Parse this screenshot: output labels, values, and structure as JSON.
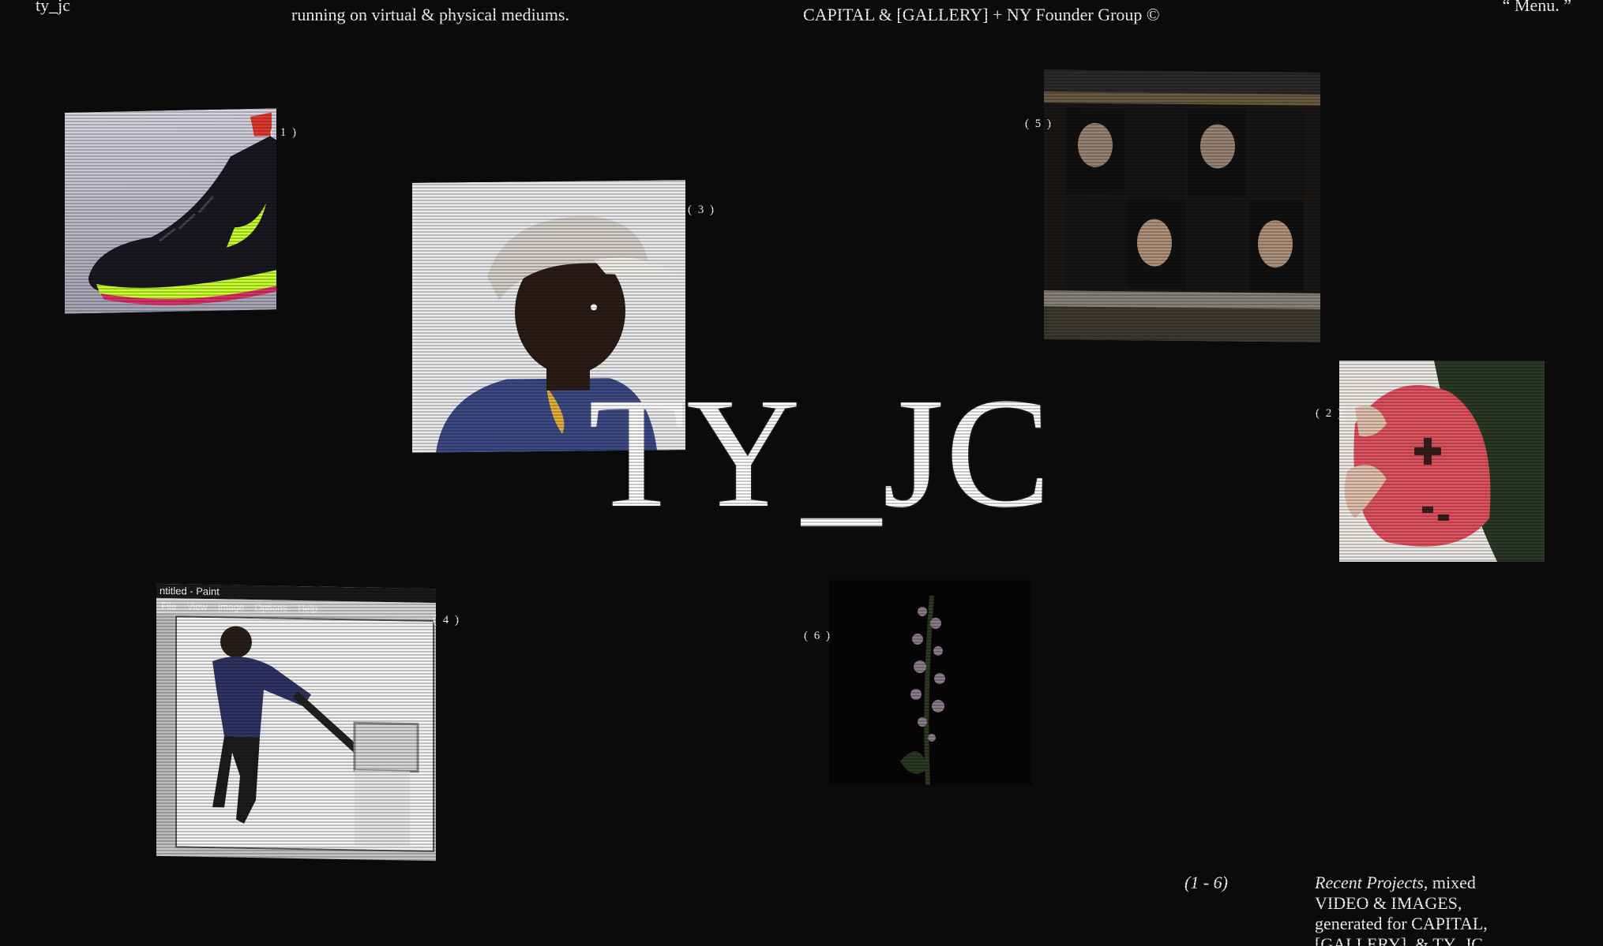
{
  "header": {
    "brand": "ty_jc",
    "description_line2": "running on virtual & physical mediums.",
    "credit": "CAPITAL & [GALLERY] + NY Founder Group ©",
    "menu_label": "“ Menu. ”"
  },
  "hero": {
    "title": "TY_JC"
  },
  "projects": [
    {
      "label": "( 1 )",
      "subject": "sneaker"
    },
    {
      "label": "( 2 )",
      "subject": "game controller"
    },
    {
      "label": "( 3 )",
      "subject": "portrait in cap"
    },
    {
      "label": "( 4 )",
      "subject": "paint window"
    },
    {
      "label": "( 5 )",
      "subject": "street posters"
    },
    {
      "label": "( 6 )",
      "subject": "flowers at night"
    }
  ],
  "paint_window": {
    "title": "ntitled - Paint",
    "menu": [
      "File",
      "View",
      "Image",
      "Options",
      "Help"
    ]
  },
  "footer": {
    "counter": "(1 - 6)",
    "recent_title": "Recent Projects",
    "recent_text": ", mixed VIDEO & IMAGES, generated for CAPITAL, [GALLERY], & TY_JC"
  },
  "colors": {
    "background": "#0b0b0b",
    "text": "#ffffff",
    "sneaker_accent": "#c8ff2e",
    "controller": "#e2535f"
  }
}
